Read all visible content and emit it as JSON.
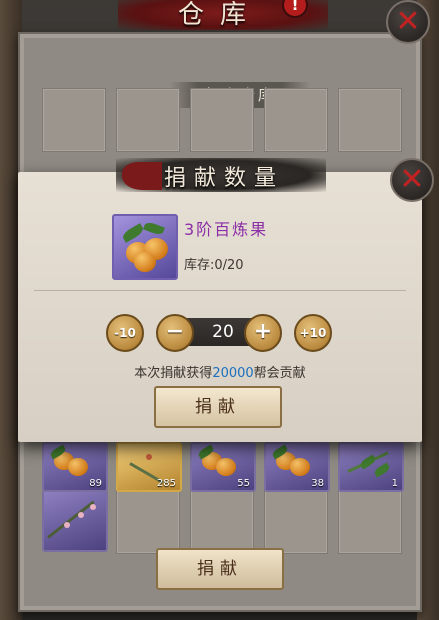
{
  "warehouse": {
    "title": "仓库",
    "alert": "!",
    "subheader": "帮会仓库",
    "items": [
      {
        "count": "89",
        "icon": "fruit-icon",
        "rarity": "purple"
      },
      {
        "count": "285",
        "icon": "branch-icon",
        "rarity": "gold"
      },
      {
        "count": "55",
        "icon": "fruit-icon",
        "rarity": "purple"
      },
      {
        "count": "38",
        "icon": "fruit-icon",
        "rarity": "purple"
      },
      {
        "count": "1",
        "icon": "herb-icon",
        "rarity": "purple"
      },
      {
        "count": "",
        "icon": "blossom-branch-icon",
        "rarity": "purple"
      }
    ],
    "donate_label": "捐献"
  },
  "dialog": {
    "title": "捐献数量",
    "item_name": "3阶百炼果",
    "stock": "库存:0/20",
    "buttons": {
      "minus10": "-10",
      "minus": "−",
      "plus": "+",
      "plus10": "+10"
    },
    "quantity": "20",
    "reward_prefix": "本次捐献获得",
    "reward_amount": "20000",
    "reward_suffix": "帮会贡献",
    "donate_label": "捐献"
  },
  "colors": {
    "item_name": "#8a2ea6",
    "reward_amount": "#1a6fc0",
    "close_x": "#c42222"
  }
}
